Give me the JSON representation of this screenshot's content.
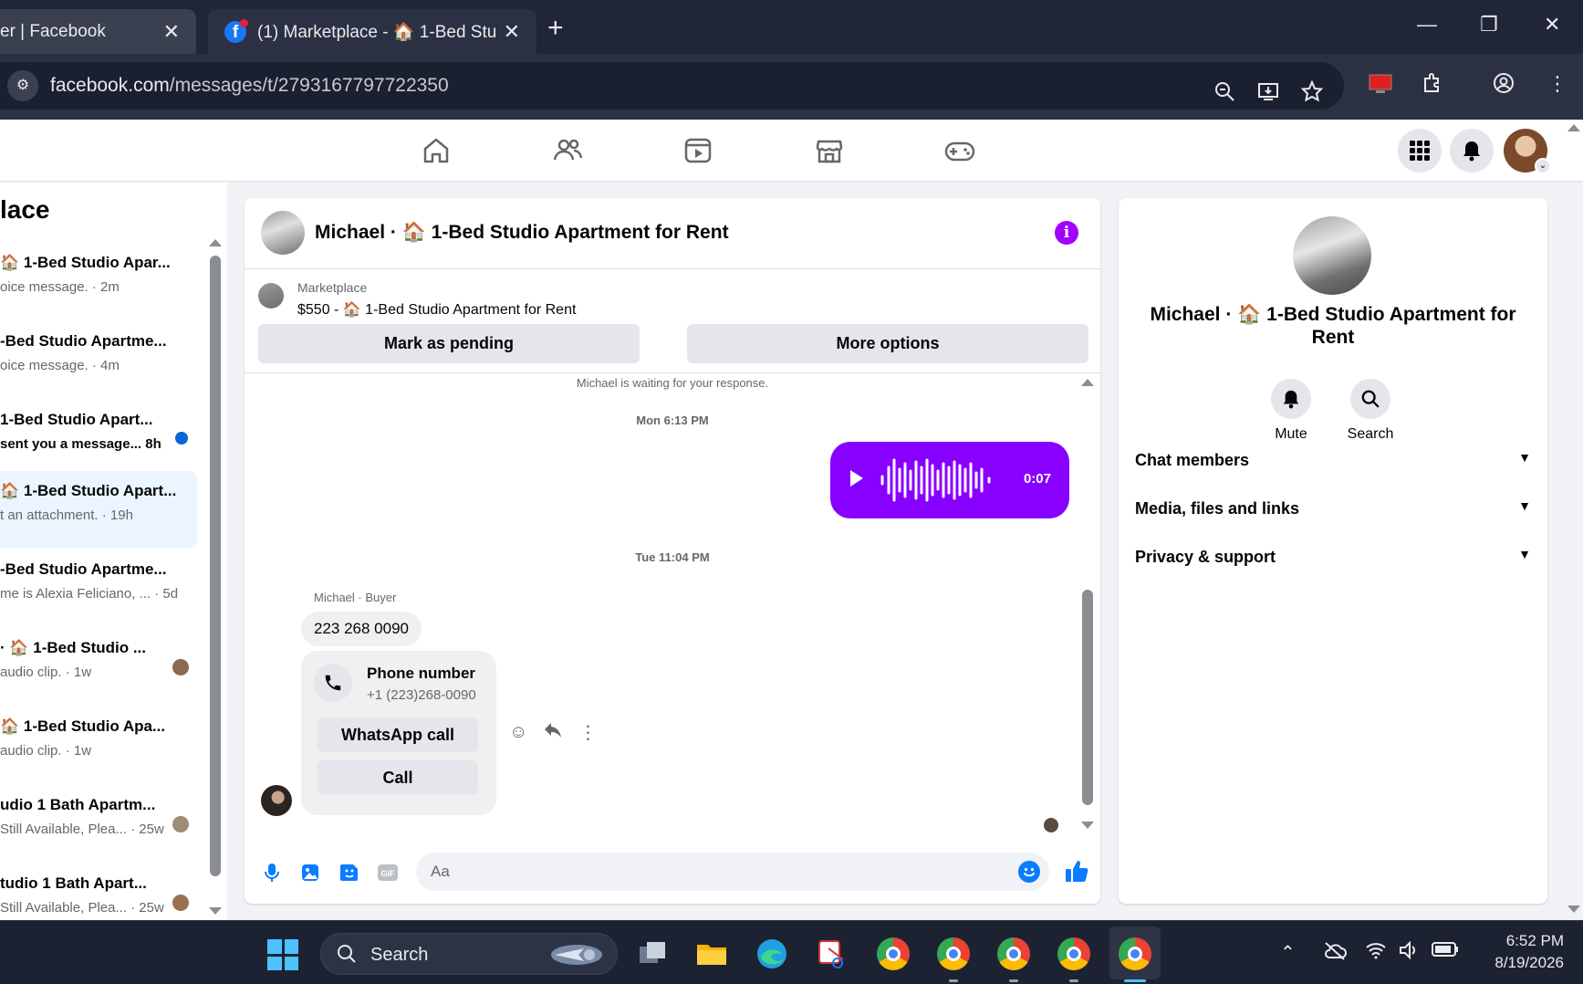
{
  "browser": {
    "tabs": [
      {
        "title": "er | Facebook",
        "active": false
      },
      {
        "title": "(1) Marketplace - 🏠 1-Bed Stu",
        "active": true
      }
    ],
    "url_host": "facebook.com",
    "url_path": "/messages/t/2793167797722350"
  },
  "fb_nav": {
    "items": [
      "home",
      "friends",
      "watch",
      "marketplace",
      "gaming"
    ]
  },
  "sidebar": {
    "title": "lace",
    "conversations": [
      {
        "title": "🏠 1-Bed Studio Apar...",
        "snippet": "oice message. · 2m",
        "unread": false
      },
      {
        "title": "-Bed Studio Apartme...",
        "snippet": "oice message. · 4m",
        "unread": false
      },
      {
        "title": "1-Bed Studio Apart...",
        "snippet": "sent you a message... 8h",
        "unread": true
      },
      {
        "title": "🏠 1-Bed Studio Apart...",
        "snippet": "t an attachment. · 19h",
        "unread": false,
        "selected": true
      },
      {
        "title": "-Bed Studio Apartme...",
        "snippet": "me is Alexia Feliciano, ...  · 5d",
        "unread": false
      },
      {
        "title": "· 🏠 1-Bed Studio ...",
        "snippet": "audio clip. · 1w",
        "unread": false
      },
      {
        "title": "🏠 1-Bed Studio Apa...",
        "snippet": "audio clip. · 1w",
        "unread": false
      },
      {
        "title": "udio 1 Bath Apartm...",
        "snippet": "Still Available, Plea... · 25w",
        "unread": false
      },
      {
        "title": "tudio 1 Bath Apart...",
        "snippet": "Still Available, Plea... · 25w",
        "unread": false
      }
    ]
  },
  "chat": {
    "header_name": "Michael · 🏠 1-Bed Studio Apartment for Rent",
    "marketplace_label": "Marketplace",
    "listing": "$550 - 🏠 1-Bed Studio Apartment for Rent",
    "mark_pending": "Mark as pending",
    "more_options": "More options",
    "waiting_text": "Michael is waiting for your response.",
    "ts1": "Mon 6:13 PM",
    "voice_duration": "0:07",
    "ts2": "Tue 11:04 PM",
    "sender_label": "Michael · Buyer",
    "message_text": "223 268 0090",
    "phone_card_title": "Phone number",
    "phone_card_number": "+1 (223)268-0090",
    "whatsapp_btn": "WhatsApp call",
    "call_btn": "Call",
    "composer_placeholder": "Aa"
  },
  "right_panel": {
    "name": "Michael · 🏠 1-Bed Studio Apartment for Rent",
    "actions": [
      {
        "label": "Mute"
      },
      {
        "label": "Search"
      }
    ],
    "sections": [
      {
        "label": "Chat members"
      },
      {
        "label": "Media, files and links"
      },
      {
        "label": "Privacy & support"
      }
    ]
  },
  "taskbar": {
    "search_label": "Search",
    "time": "6:52 PM",
    "date": "8/19/2026"
  },
  "colors": {
    "accent_purple": "#8800ff",
    "fb_blue": "#0a7cff",
    "unread_dot": "#0a66d8"
  }
}
